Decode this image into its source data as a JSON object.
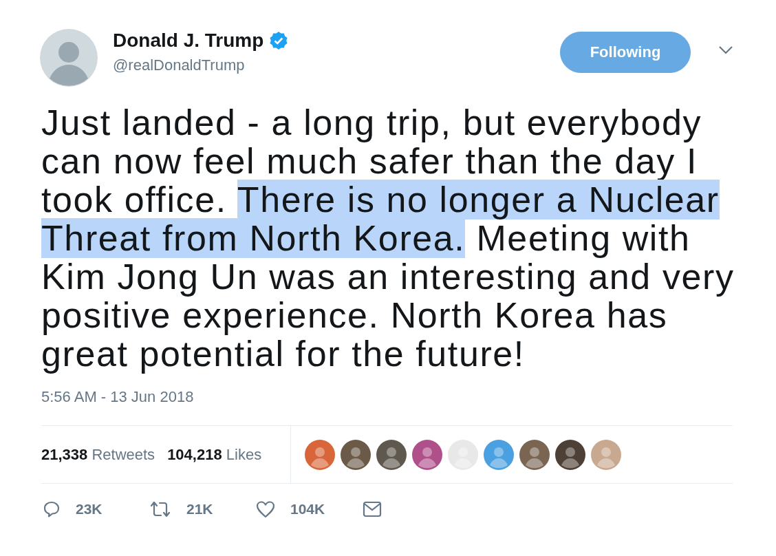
{
  "author": {
    "name": "Donald J. Trump",
    "verified": true,
    "handle": "@realDonaldTrump"
  },
  "follow_button": {
    "label": "Following",
    "selected": true
  },
  "tweet": {
    "segments": [
      {
        "text": "Just landed - a long trip, but everybody can now feel much safer than the day I took office. ",
        "highlighted": false
      },
      {
        "text": "There is no longer a Nuclear Threat from North Korea.",
        "highlighted": true
      },
      {
        "text": " Meeting with Kim Jong Un was an interesting and very positive experience. North Korea has great potential for the future!",
        "highlighted": false
      }
    ]
  },
  "timestamp": "5:56 AM - 13 Jun 2018",
  "stats": [
    {
      "count": "21,338",
      "label": "Retweets"
    },
    {
      "count": "104,218",
      "label": "Likes"
    }
  ],
  "likers": [
    {
      "color": "#d9663a"
    },
    {
      "color": "#6b5a48"
    },
    {
      "color": "#5e584e"
    },
    {
      "color": "#b0508a"
    },
    {
      "color": "#e8e8e8"
    },
    {
      "color": "#4aa0e0"
    },
    {
      "color": "#7a6552"
    },
    {
      "color": "#4d4036"
    },
    {
      "color": "#c9a890"
    }
  ],
  "actions": [
    {
      "kind": "reply",
      "count": "23K"
    },
    {
      "kind": "retweet",
      "count": "21K"
    },
    {
      "kind": "like",
      "count": "104K"
    },
    {
      "kind": "message"
    }
  ]
}
